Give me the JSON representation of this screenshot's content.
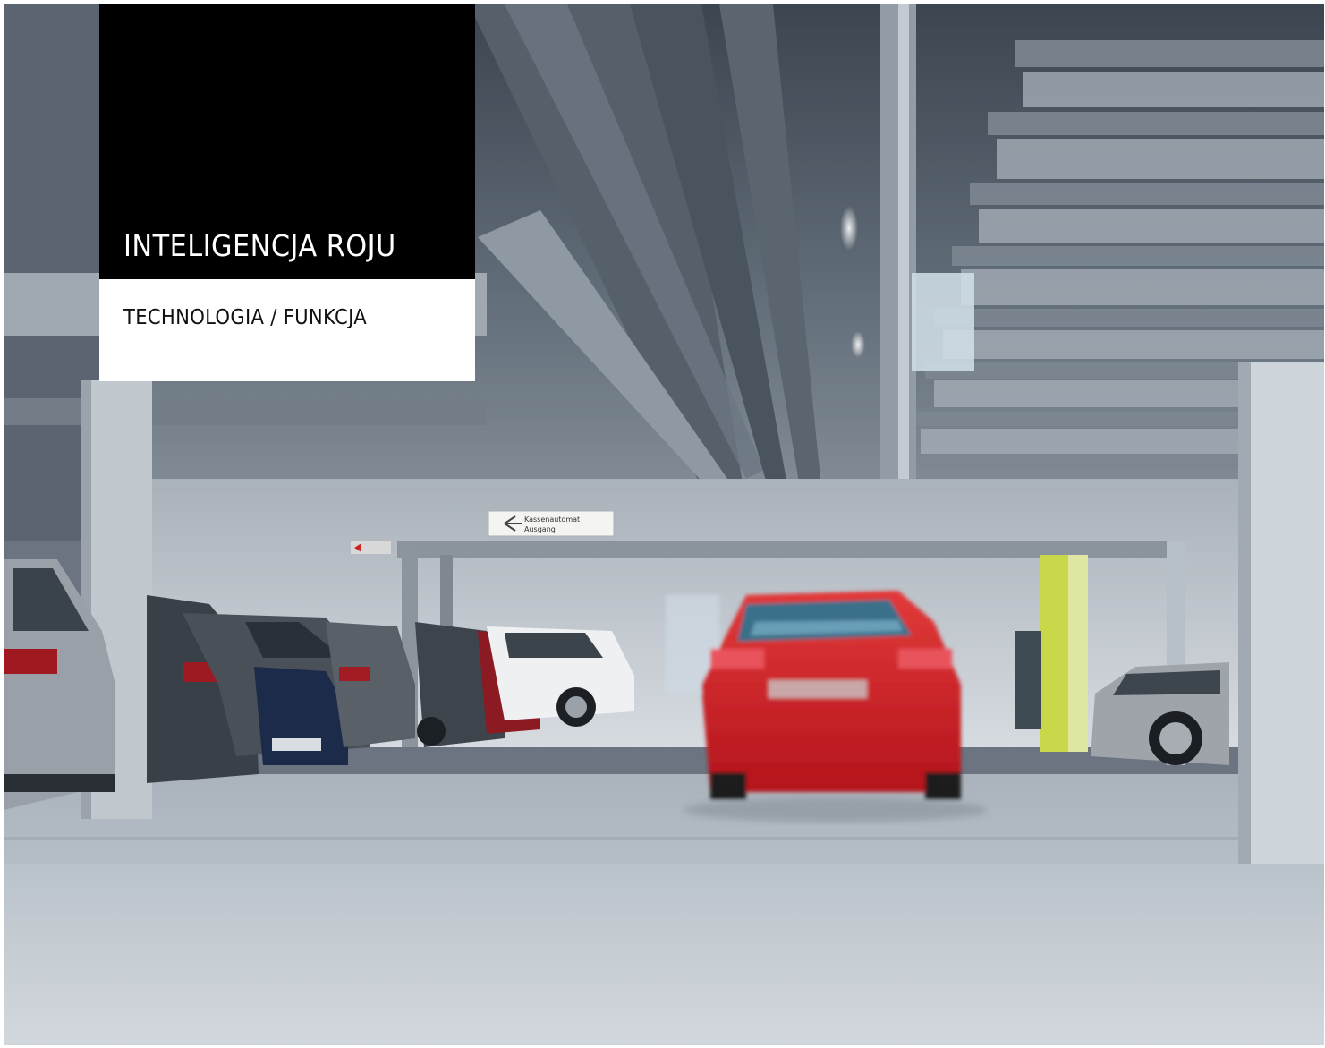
{
  "card": {
    "title": "INTELIGENCJA ROJU",
    "subtitle": "TECHNOLOGIA / FUNKCJA"
  },
  "scene": {
    "exit_sign": {
      "line1": "Kassenautomat",
      "line2": "Ausgang"
    }
  },
  "colors": {
    "card_dark": "#000000",
    "card_light": "#ffffff",
    "car_accent": "#d8202a",
    "pillar_accent": "#c9d84a"
  }
}
